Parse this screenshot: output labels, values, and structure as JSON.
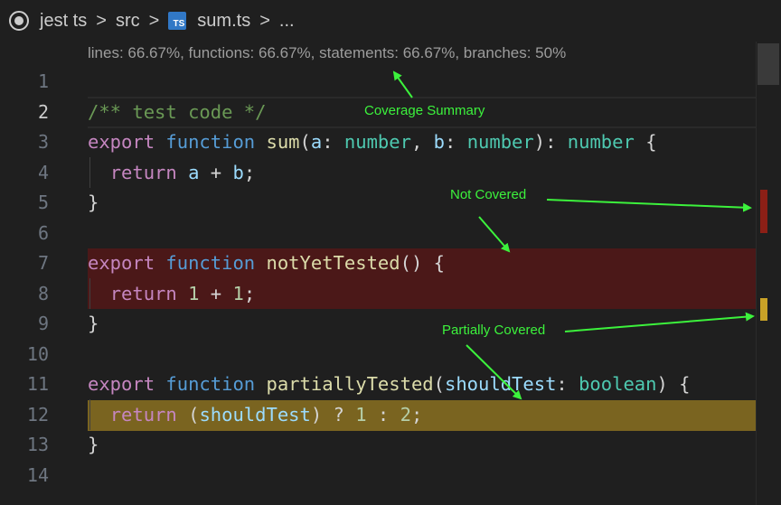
{
  "breadcrumb": {
    "items": [
      "jest ts",
      "src",
      "sum.ts",
      "..."
    ],
    "separator": ">",
    "file_icon_label": "TS"
  },
  "coverage_summary": "lines: 66.67%, functions: 66.67%, statements: 66.67%, branches: 50%",
  "editor": {
    "active_line": 2,
    "line_numbers": [
      "1",
      "2",
      "3",
      "4",
      "5",
      "6",
      "7",
      "8",
      "9",
      "10",
      "11",
      "12",
      "13",
      "14"
    ]
  },
  "annotations": {
    "coverage_summary": "Coverage Summary",
    "not_covered": "Not Covered",
    "partially_covered": "Partially Covered"
  },
  "colors": {
    "not_covered_bg": "#4b1818",
    "partially_covered_bg": "#7a6420",
    "annotation": "#3cf23c"
  }
}
